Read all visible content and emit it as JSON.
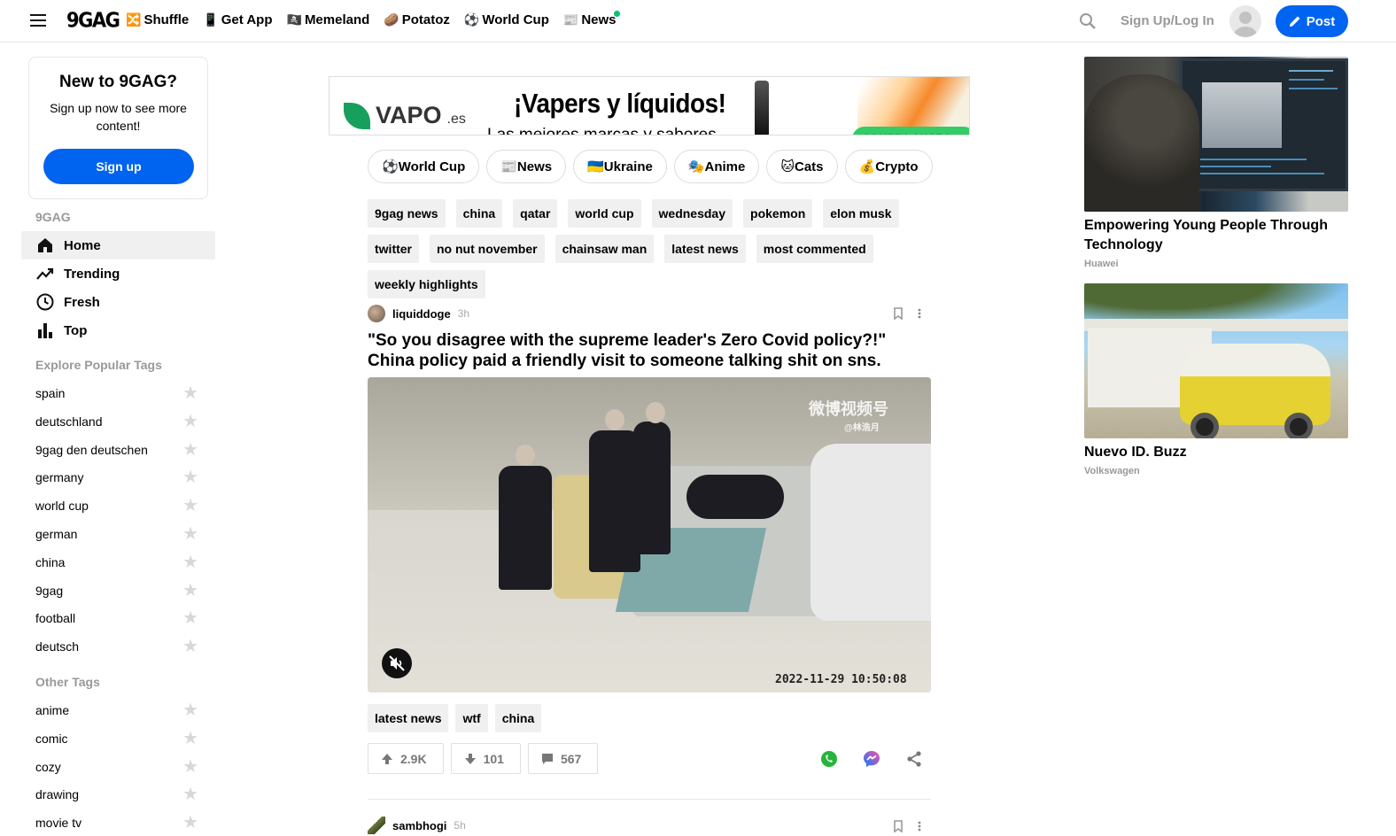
{
  "header": {
    "logo": "9GAG",
    "nav": [
      {
        "icon": "🔀",
        "label": "Shuffle"
      },
      {
        "icon": "📱",
        "label": "Get App"
      },
      {
        "icon": "🏴‍☠️",
        "label": "Memeland"
      },
      {
        "icon": "🥔",
        "label": "Potatoz"
      },
      {
        "icon": "⚽",
        "label": "World Cup"
      },
      {
        "icon": "📰",
        "label": "News"
      }
    ],
    "signin": "Sign Up/Log In",
    "post_label": "Post"
  },
  "sidebar": {
    "card_title": "New to 9GAG?",
    "card_text": "Sign up now to see more content!",
    "signup_label": "Sign up",
    "section_main": "9GAG",
    "menu": [
      {
        "label": "Home",
        "icon": "home-icon"
      },
      {
        "label": "Trending",
        "icon": "trending-icon"
      },
      {
        "label": "Fresh",
        "icon": "clock-icon"
      },
      {
        "label": "Top",
        "icon": "bar-chart-icon"
      }
    ],
    "section_popular": "Explore Popular Tags",
    "popular_tags": [
      "spain",
      "deutschland",
      "9gag den deutschen",
      "germany",
      "world cup",
      "german",
      "china",
      "9gag",
      "football",
      "deutsch"
    ],
    "section_other": "Other Tags",
    "other_tags": [
      "anime",
      "comic",
      "cozy",
      "drawing",
      "movie tv"
    ]
  },
  "ad": {
    "brand": "VAPO",
    "brand_suffix": ".es",
    "headline": "¡Vapers y líquidos!",
    "subline": "Las mejores marcas y sabores",
    "cta": "COMPRA AHORA"
  },
  "categories": [
    {
      "icon": "⚽",
      "label": "World Cup"
    },
    {
      "icon": "📰",
      "label": "News"
    },
    {
      "icon": "🇺🇦",
      "label": "Ukraine"
    },
    {
      "icon": "🎭",
      "label": "Anime"
    },
    {
      "icon": "🐱",
      "label": "Cats"
    },
    {
      "icon": "💰",
      "label": "Crypto"
    }
  ],
  "tag_chips": [
    "9gag news",
    "china",
    "qatar",
    "world cup",
    "wednesday",
    "pokemon",
    "elon musk",
    "twitter",
    "no nut november",
    "chainsaw man",
    "latest news",
    "most commented",
    "weekly highlights"
  ],
  "post": {
    "user": "liquiddoge",
    "ago": "3h",
    "title": "\"So you disagree with the supreme leader's Zero Covid policy?!\" China policy paid a friendly visit to someone talking shit on sns.",
    "watermark": "微博视频号",
    "watermark_sub": "@林浩月",
    "timestamp": "2022-11-29 10:50:08",
    "tags": [
      "latest news",
      "wtf",
      "china"
    ],
    "upvotes": "2.9K",
    "downvotes": "101",
    "comments": "567"
  },
  "next_post": {
    "user": "sambhogi",
    "ago": "5h"
  },
  "right_ads": [
    {
      "title": "Empowering Young People Through Technology",
      "source": "Huawei"
    },
    {
      "title": "Nuevo ID. Buzz",
      "source": "Volkswagen"
    }
  ]
}
